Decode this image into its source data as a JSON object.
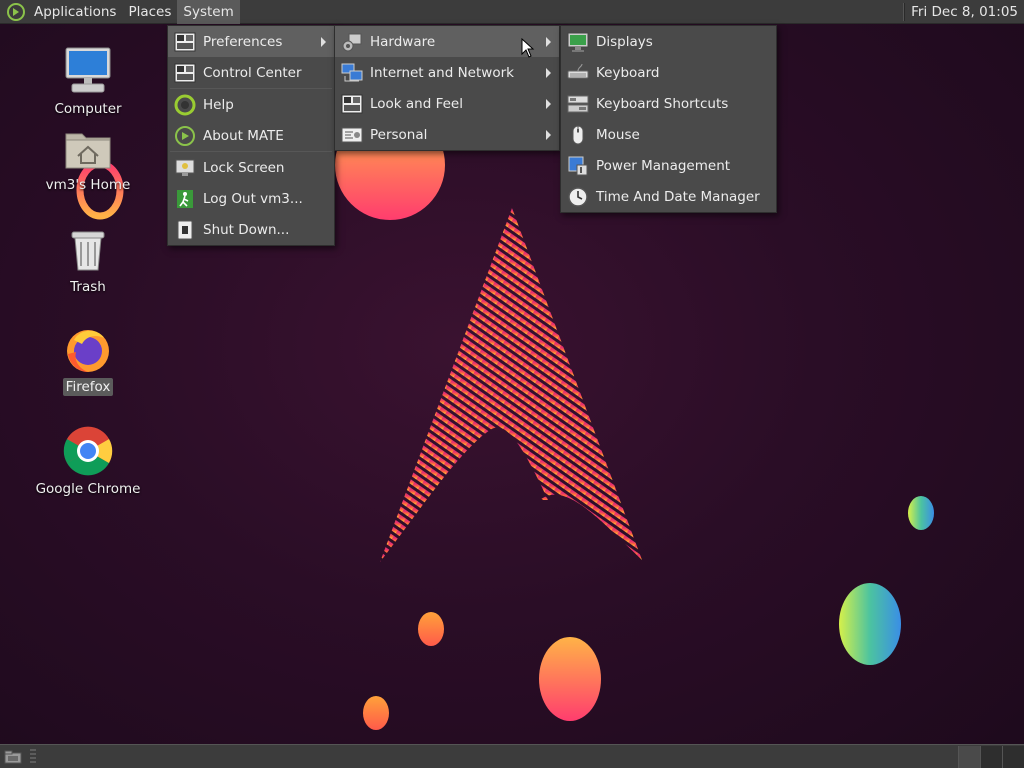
{
  "top_panel": {
    "menus": [
      "Applications",
      "Places",
      "System"
    ],
    "clock": "Fri Dec  8, 01:05"
  },
  "desktop": {
    "icons": [
      {
        "label": "Computer",
        "icon": "computer-icon"
      },
      {
        "label": "vm3's Home",
        "icon": "home-folder-icon"
      },
      {
        "label": "Trash",
        "icon": "trash-icon"
      },
      {
        "label": "Firefox",
        "icon": "firefox-icon",
        "selected": true
      },
      {
        "label": "Google Chrome",
        "icon": "chrome-icon"
      }
    ]
  },
  "system_menu": {
    "items": [
      {
        "label": "Preferences",
        "icon": "preferences-icon",
        "submenu": true,
        "highlighted": true
      },
      {
        "label": "Control Center",
        "icon": "control-center-icon"
      },
      {
        "label": "Help",
        "icon": "help-icon"
      },
      {
        "label": "About MATE",
        "icon": "mate-icon"
      },
      {
        "label": "Lock Screen",
        "icon": "lock-screen-icon"
      },
      {
        "label": "Log Out vm3...",
        "icon": "logout-icon"
      },
      {
        "label": "Shut Down...",
        "icon": "shutdown-icon"
      }
    ]
  },
  "preferences_menu": {
    "items": [
      {
        "label": "Hardware",
        "icon": "hardware-icon",
        "submenu": true,
        "highlighted": true
      },
      {
        "label": "Internet and Network",
        "icon": "network-icon",
        "submenu": true
      },
      {
        "label": "Look and Feel",
        "icon": "look-and-feel-icon",
        "submenu": true
      },
      {
        "label": "Personal",
        "icon": "personal-icon",
        "submenu": true
      }
    ]
  },
  "hardware_menu": {
    "items": [
      {
        "label": "Displays",
        "icon": "display-icon"
      },
      {
        "label": "Keyboard",
        "icon": "keyboard-icon"
      },
      {
        "label": "Keyboard Shortcuts",
        "icon": "keyboard-shortcuts-icon"
      },
      {
        "label": "Mouse",
        "icon": "mouse-icon"
      },
      {
        "label": "Power Management",
        "icon": "power-management-icon"
      },
      {
        "label": "Time And Date Manager",
        "icon": "clock-icon"
      }
    ]
  },
  "colors": {
    "panel_bg": "#3c3c3c",
    "menu_bg": "#4a4a4a",
    "menu_highlight": "#606060",
    "wallpaper": "#2a0d26",
    "accent_pink": "#e0306a",
    "accent_orange": "#ff9a3c"
  }
}
